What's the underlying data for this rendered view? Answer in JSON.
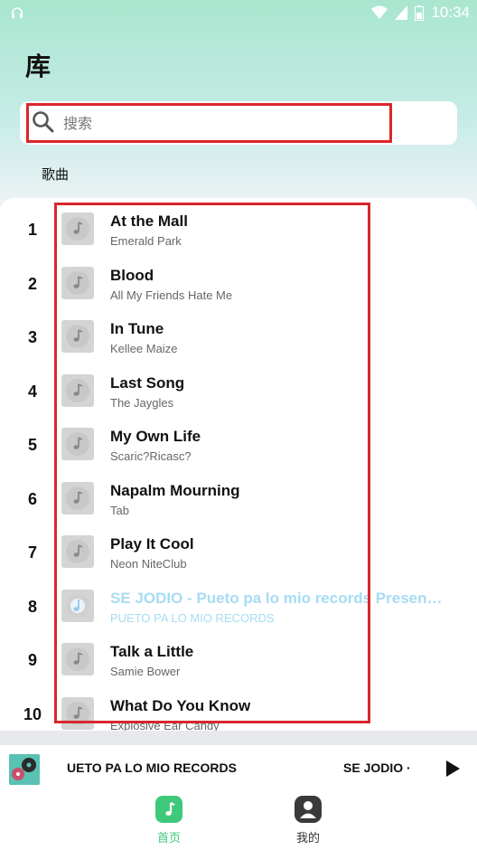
{
  "status_bar": {
    "time": "10:34"
  },
  "page": {
    "title": "库"
  },
  "search": {
    "placeholder": "搜索",
    "value": ""
  },
  "section": {
    "label": "歌曲"
  },
  "songs": [
    {
      "num": "1",
      "title": "At the Mall",
      "artist": "Emerald Park"
    },
    {
      "num": "2",
      "title": "Blood",
      "artist": "All My Friends Hate Me"
    },
    {
      "num": "3",
      "title": "In Tune",
      "artist": "Kellee Maize"
    },
    {
      "num": "4",
      "title": "Last Song",
      "artist": "The Jaygles"
    },
    {
      "num": "5",
      "title": "My Own Life",
      "artist": "Scaric?Ricasc?"
    },
    {
      "num": "6",
      "title": "Napalm Mourning",
      "artist": "Tab"
    },
    {
      "num": "7",
      "title": "Play It Cool",
      "artist": "Neon NiteClub"
    },
    {
      "num": "8",
      "title": "SE JODIO - Pueto pa lo mio records Presenta -...",
      "artist": "PUETO PA LO MIO RECORDS",
      "playing": true
    },
    {
      "num": "9",
      "title": "Talk a Little",
      "artist": "Samie Bower"
    },
    {
      "num": "10",
      "title": "What Do You Know",
      "artist": "Explosive Ear Candy"
    }
  ],
  "mini_player": {
    "artist_marquee": "UETO PA LO MIO RECORDS",
    "title_marquee": "SE JODIO ·",
    "icons": {
      "cover": "album-cover",
      "play": "play-icon"
    }
  },
  "tabs": [
    {
      "label": "首页",
      "icon": "music-note-icon",
      "active": true
    },
    {
      "label": "我的",
      "icon": "user-icon",
      "active": false
    }
  ],
  "colors": {
    "accent": "#3ec97a",
    "playing_text": "#a6dcf3",
    "highlight_box": "#d9262c",
    "gradient_top": "#a9e6cf"
  }
}
